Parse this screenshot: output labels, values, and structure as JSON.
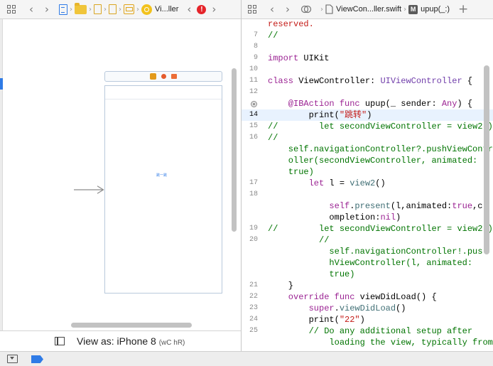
{
  "left_jumpbar": {
    "breadcrumb_last": "Vi...ller"
  },
  "right_jumpbar": {
    "file_name": "ViewCon...ller.swift",
    "method_badge": "M",
    "method_name": "upup(_:)",
    "add_label": "+"
  },
  "storyboard": {
    "scene_button_text": "跳一跳"
  },
  "bottom_bar": {
    "view_as_label": "View as: iPhone 8",
    "size_class": "(wC hR)"
  },
  "code_lines": [
    {
      "num": "",
      "segs": [
        {
          "t": "reserved.",
          "c": "#c41a16"
        }
      ]
    },
    {
      "num": "7",
      "segs": [
        {
          "t": "//",
          "c": "#007400"
        }
      ]
    },
    {
      "num": "8",
      "segs": []
    },
    {
      "num": "9",
      "segs": [
        {
          "t": "import",
          "c": "#9b2393"
        },
        {
          "t": " UIKit",
          "c": "#000000"
        }
      ]
    },
    {
      "num": "10",
      "segs": []
    },
    {
      "num": "11",
      "segs": [
        {
          "t": "class",
          "c": "#9b2393"
        },
        {
          "t": " ViewController: ",
          "c": "#000000"
        },
        {
          "t": "UIViewController",
          "c": "#703daa"
        },
        {
          "t": " {",
          "c": "#000000"
        }
      ]
    },
    {
      "num": "12",
      "segs": []
    },
    {
      "num": "",
      "bp": true,
      "segs": [
        {
          "t": "    @IBAction",
          "c": "#9b2393"
        },
        {
          "t": " func",
          "c": "#9b2393"
        },
        {
          "t": " upup(_ sender: ",
          "c": "#000000"
        },
        {
          "t": "Any",
          "c": "#9b2393"
        },
        {
          "t": ") {",
          "c": "#000000"
        }
      ]
    },
    {
      "num": "14",
      "hl": true,
      "segs": [
        {
          "t": "        print(",
          "c": "#000000"
        },
        {
          "t": "\"跳转\"",
          "c": "#c41a16"
        },
        {
          "t": ")",
          "c": "#000000"
        }
      ]
    },
    {
      "num": "15",
      "segs": [
        {
          "t": "//        let secondViewController = view2()",
          "c": "#007400"
        }
      ]
    },
    {
      "num": "16",
      "segs": [
        {
          "t": "//",
          "c": "#007400"
        }
      ]
    },
    {
      "num": "",
      "segs": [
        {
          "t": "    self.navigationController?.pushViewContr",
          "c": "#007400"
        }
      ]
    },
    {
      "num": "",
      "segs": [
        {
          "t": "    oller(secondViewController, animated:",
          "c": "#007400"
        }
      ]
    },
    {
      "num": "",
      "segs": [
        {
          "t": "    true)",
          "c": "#007400"
        }
      ]
    },
    {
      "num": "17",
      "segs": [
        {
          "t": "        let",
          "c": "#9b2393"
        },
        {
          "t": " l = ",
          "c": "#000000"
        },
        {
          "t": "view2",
          "c": "#3f6e74"
        },
        {
          "t": "()",
          "c": "#000000"
        }
      ]
    },
    {
      "num": "18",
      "segs": []
    },
    {
      "num": "",
      "segs": [
        {
          "t": "            self",
          "c": "#9b2393"
        },
        {
          "t": ".",
          "c": "#000000"
        },
        {
          "t": "present",
          "c": "#3f6e74"
        },
        {
          "t": "(l,animated:",
          "c": "#000000"
        },
        {
          "t": "true",
          "c": "#9b2393"
        },
        {
          "t": ",c",
          "c": "#000000"
        }
      ]
    },
    {
      "num": "",
      "segs": [
        {
          "t": "            ompletion:",
          "c": "#000000"
        },
        {
          "t": "nil",
          "c": "#9b2393"
        },
        {
          "t": ")",
          "c": "#000000"
        }
      ]
    },
    {
      "num": "19",
      "segs": [
        {
          "t": "//        let secondViewController = view2()",
          "c": "#007400"
        }
      ]
    },
    {
      "num": "20",
      "segs": [
        {
          "t": "          //",
          "c": "#007400"
        }
      ]
    },
    {
      "num": "",
      "segs": [
        {
          "t": "            self.navigationController!.pus",
          "c": "#007400"
        }
      ]
    },
    {
      "num": "",
      "segs": [
        {
          "t": "            hViewController(l, animated:",
          "c": "#007400"
        }
      ]
    },
    {
      "num": "",
      "segs": [
        {
          "t": "            true)",
          "c": "#007400"
        }
      ]
    },
    {
      "num": "21",
      "segs": [
        {
          "t": "    }",
          "c": "#000000"
        }
      ]
    },
    {
      "num": "22",
      "segs": [
        {
          "t": "    override",
          "c": "#9b2393"
        },
        {
          "t": " func",
          "c": "#9b2393"
        },
        {
          "t": " viewDidLoad() {",
          "c": "#000000"
        }
      ]
    },
    {
      "num": "23",
      "segs": [
        {
          "t": "        super",
          "c": "#9b2393"
        },
        {
          "t": ".",
          "c": "#000000"
        },
        {
          "t": "viewDidLoad",
          "c": "#3f6e74"
        },
        {
          "t": "()",
          "c": "#000000"
        }
      ]
    },
    {
      "num": "24",
      "segs": [
        {
          "t": "        print(",
          "c": "#000000"
        },
        {
          "t": "\"22\"",
          "c": "#c41a16"
        },
        {
          "t": ")",
          "c": "#000000"
        }
      ]
    },
    {
      "num": "25",
      "segs": [
        {
          "t": "        // Do any additional setup after",
          "c": "#007400"
        }
      ]
    },
    {
      "num": "",
      "segs": [
        {
          "t": "            loading the view, typically from",
          "c": "#007400"
        }
      ]
    }
  ]
}
